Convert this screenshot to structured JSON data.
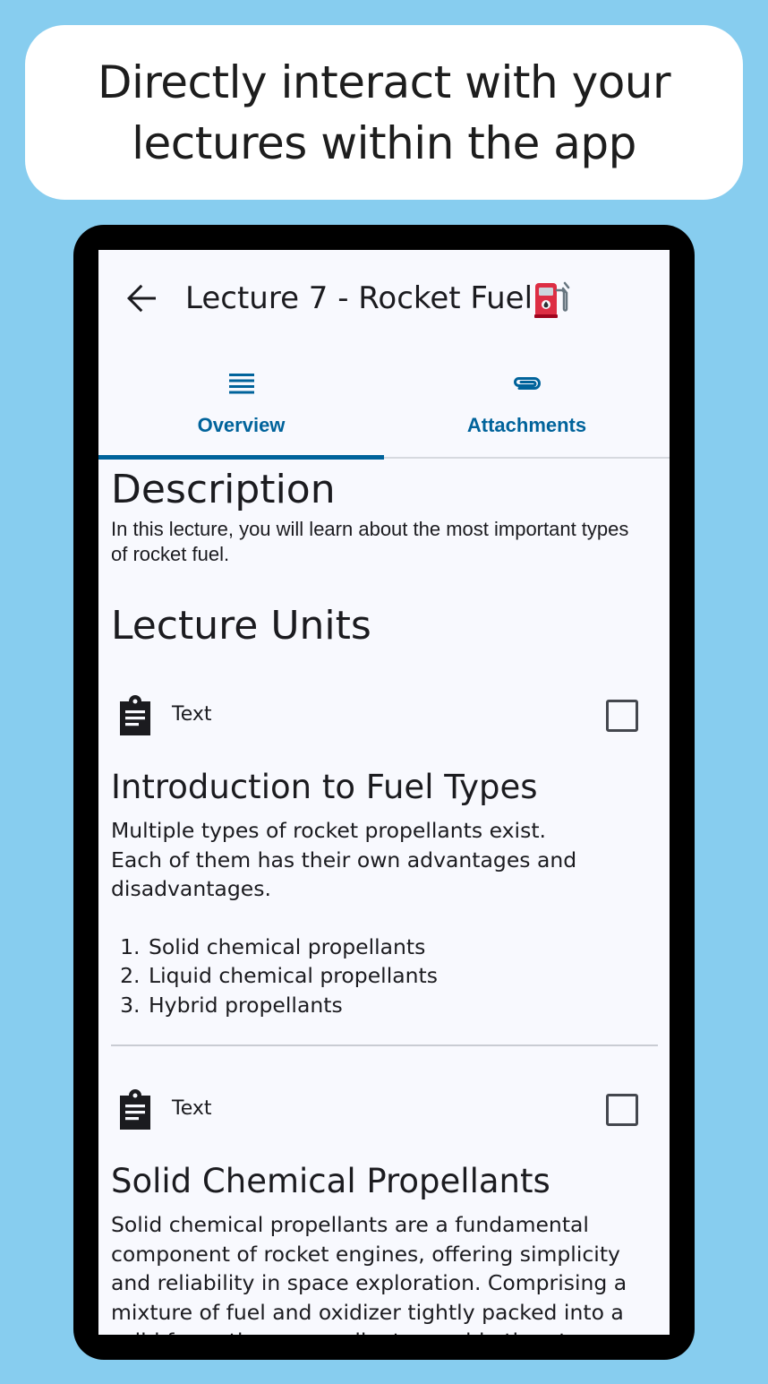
{
  "banner": {
    "line1": "Directly interact with your",
    "line2": "lectures within the app"
  },
  "appbar": {
    "back_icon": "arrow-left-icon",
    "title": "Lecture 7 - Rocket Fuel",
    "title_emoji_icon": "fuel-pump-icon"
  },
  "tabs": [
    {
      "label": "Overview",
      "icon": "list-lines-icon",
      "selected": true
    },
    {
      "label": "Attachments",
      "icon": "paperclip-icon",
      "selected": false
    }
  ],
  "description": {
    "heading": "Description",
    "text": "In this lecture, you will learn about the most important types of rocket fuel."
  },
  "lecture_units": {
    "heading": "Lecture Units",
    "units": [
      {
        "type": "Text",
        "icon": "clipboard-text-icon",
        "checked": false,
        "title": "Introduction to Fuel Types",
        "paragraph1": "Multiple types of rocket propellants exist.",
        "paragraph2": "Each of them has their own advantages and disadvantages.",
        "list": [
          "Solid chemical propellants",
          "Liquid chemical propellants",
          "Hybrid propellants"
        ]
      },
      {
        "type": "Text",
        "icon": "clipboard-text-icon",
        "checked": false,
        "title": "Solid Chemical Propellants",
        "paragraph1": "Solid chemical propellants are a fundamental component of rocket engines, offering simplicity and reliability in space exploration. Comprising a mixture of fuel and oxidizer tightly packed into a solid form, these propellants provide thrust"
      }
    ]
  },
  "colors": {
    "background": "#87CDEF",
    "accent": "#00639B",
    "surface": "#F8F9FE",
    "text": "#1B1B1F"
  }
}
